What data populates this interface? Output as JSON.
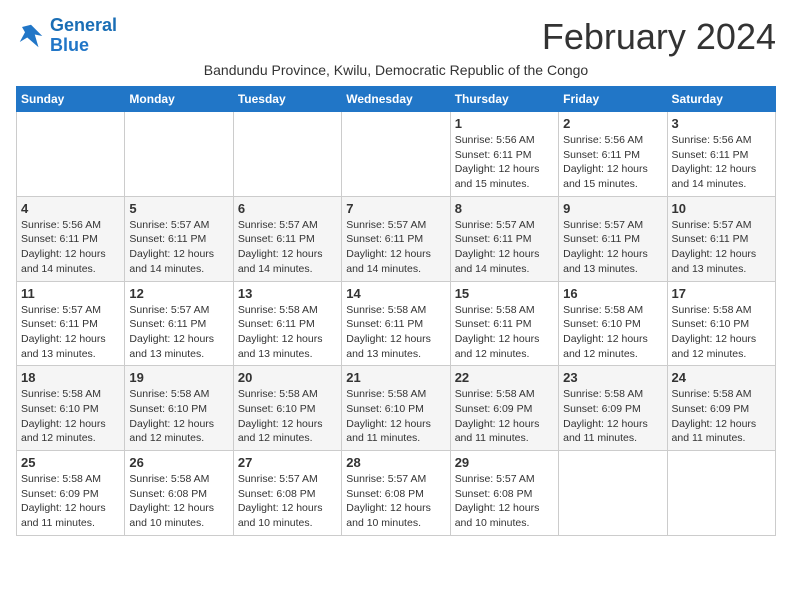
{
  "logo": {
    "line1": "General",
    "line2": "Blue"
  },
  "title": "February 2024",
  "subtitle": "Bandundu Province, Kwilu, Democratic Republic of the Congo",
  "weekdays": [
    "Sunday",
    "Monday",
    "Tuesday",
    "Wednesday",
    "Thursday",
    "Friday",
    "Saturday"
  ],
  "weeks": [
    [
      {
        "day": "",
        "info": ""
      },
      {
        "day": "",
        "info": ""
      },
      {
        "day": "",
        "info": ""
      },
      {
        "day": "",
        "info": ""
      },
      {
        "day": "1",
        "info": "Sunrise: 5:56 AM\nSunset: 6:11 PM\nDaylight: 12 hours\nand 15 minutes."
      },
      {
        "day": "2",
        "info": "Sunrise: 5:56 AM\nSunset: 6:11 PM\nDaylight: 12 hours\nand 15 minutes."
      },
      {
        "day": "3",
        "info": "Sunrise: 5:56 AM\nSunset: 6:11 PM\nDaylight: 12 hours\nand 14 minutes."
      }
    ],
    [
      {
        "day": "4",
        "info": "Sunrise: 5:56 AM\nSunset: 6:11 PM\nDaylight: 12 hours\nand 14 minutes."
      },
      {
        "day": "5",
        "info": "Sunrise: 5:57 AM\nSunset: 6:11 PM\nDaylight: 12 hours\nand 14 minutes."
      },
      {
        "day": "6",
        "info": "Sunrise: 5:57 AM\nSunset: 6:11 PM\nDaylight: 12 hours\nand 14 minutes."
      },
      {
        "day": "7",
        "info": "Sunrise: 5:57 AM\nSunset: 6:11 PM\nDaylight: 12 hours\nand 14 minutes."
      },
      {
        "day": "8",
        "info": "Sunrise: 5:57 AM\nSunset: 6:11 PM\nDaylight: 12 hours\nand 14 minutes."
      },
      {
        "day": "9",
        "info": "Sunrise: 5:57 AM\nSunset: 6:11 PM\nDaylight: 12 hours\nand 13 minutes."
      },
      {
        "day": "10",
        "info": "Sunrise: 5:57 AM\nSunset: 6:11 PM\nDaylight: 12 hours\nand 13 minutes."
      }
    ],
    [
      {
        "day": "11",
        "info": "Sunrise: 5:57 AM\nSunset: 6:11 PM\nDaylight: 12 hours\nand 13 minutes."
      },
      {
        "day": "12",
        "info": "Sunrise: 5:57 AM\nSunset: 6:11 PM\nDaylight: 12 hours\nand 13 minutes."
      },
      {
        "day": "13",
        "info": "Sunrise: 5:58 AM\nSunset: 6:11 PM\nDaylight: 12 hours\nand 13 minutes."
      },
      {
        "day": "14",
        "info": "Sunrise: 5:58 AM\nSunset: 6:11 PM\nDaylight: 12 hours\nand 13 minutes."
      },
      {
        "day": "15",
        "info": "Sunrise: 5:58 AM\nSunset: 6:11 PM\nDaylight: 12 hours\nand 12 minutes."
      },
      {
        "day": "16",
        "info": "Sunrise: 5:58 AM\nSunset: 6:10 PM\nDaylight: 12 hours\nand 12 minutes."
      },
      {
        "day": "17",
        "info": "Sunrise: 5:58 AM\nSunset: 6:10 PM\nDaylight: 12 hours\nand 12 minutes."
      }
    ],
    [
      {
        "day": "18",
        "info": "Sunrise: 5:58 AM\nSunset: 6:10 PM\nDaylight: 12 hours\nand 12 minutes."
      },
      {
        "day": "19",
        "info": "Sunrise: 5:58 AM\nSunset: 6:10 PM\nDaylight: 12 hours\nand 12 minutes."
      },
      {
        "day": "20",
        "info": "Sunrise: 5:58 AM\nSunset: 6:10 PM\nDaylight: 12 hours\nand 12 minutes."
      },
      {
        "day": "21",
        "info": "Sunrise: 5:58 AM\nSunset: 6:10 PM\nDaylight: 12 hours\nand 11 minutes."
      },
      {
        "day": "22",
        "info": "Sunrise: 5:58 AM\nSunset: 6:09 PM\nDaylight: 12 hours\nand 11 minutes."
      },
      {
        "day": "23",
        "info": "Sunrise: 5:58 AM\nSunset: 6:09 PM\nDaylight: 12 hours\nand 11 minutes."
      },
      {
        "day": "24",
        "info": "Sunrise: 5:58 AM\nSunset: 6:09 PM\nDaylight: 12 hours\nand 11 minutes."
      }
    ],
    [
      {
        "day": "25",
        "info": "Sunrise: 5:58 AM\nSunset: 6:09 PM\nDaylight: 12 hours\nand 11 minutes."
      },
      {
        "day": "26",
        "info": "Sunrise: 5:58 AM\nSunset: 6:08 PM\nDaylight: 12 hours\nand 10 minutes."
      },
      {
        "day": "27",
        "info": "Sunrise: 5:57 AM\nSunset: 6:08 PM\nDaylight: 12 hours\nand 10 minutes."
      },
      {
        "day": "28",
        "info": "Sunrise: 5:57 AM\nSunset: 6:08 PM\nDaylight: 12 hours\nand 10 minutes."
      },
      {
        "day": "29",
        "info": "Sunrise: 5:57 AM\nSunset: 6:08 PM\nDaylight: 12 hours\nand 10 minutes."
      },
      {
        "day": "",
        "info": ""
      },
      {
        "day": "",
        "info": ""
      }
    ]
  ]
}
